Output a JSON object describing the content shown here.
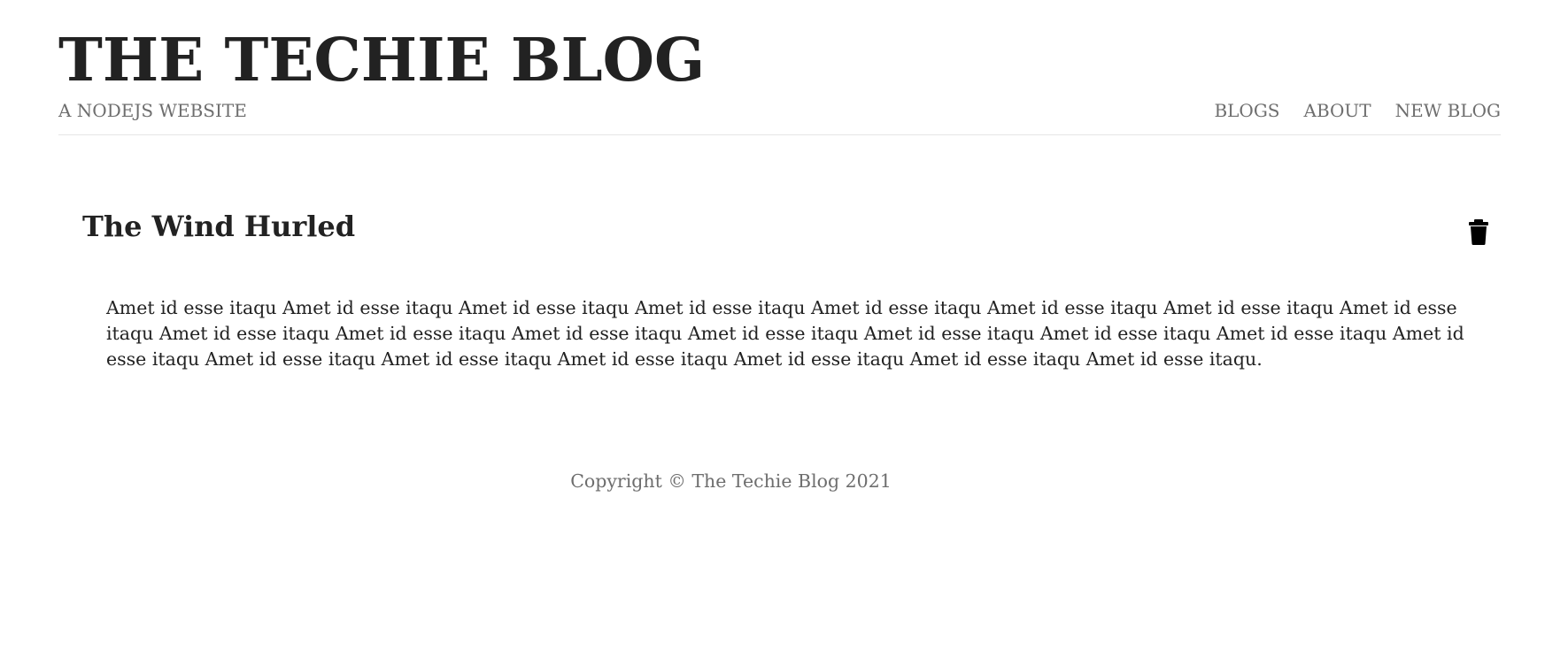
{
  "header": {
    "title": "THE TECHIE BLOG",
    "subtitle": "A NODEJS WEBSITE",
    "nav": [
      {
        "label": "BLOGS"
      },
      {
        "label": "ABOUT"
      },
      {
        "label": "NEW BLOG"
      }
    ]
  },
  "post": {
    "title": "The Wind Hurled",
    "delete_icon": "trash-icon",
    "body": "Amet id esse itaqu Amet id esse itaqu Amet id esse itaqu Amet id esse itaqu Amet id esse itaqu Amet id esse itaqu Amet id esse itaqu Amet id esse itaqu Amet id esse itaqu Amet id esse itaqu Amet id esse itaqu Amet id esse itaqu Amet id esse itaqu Amet id esse itaqu Amet id esse itaqu Amet id esse itaqu Amet id esse itaqu Amet id esse itaqu Amet id esse itaqu Amet id esse itaqu Amet id esse itaqu Amet id esse itaqu."
  },
  "footer": {
    "copyright": "Copyright © The Techie Blog 2021"
  },
  "colors": {
    "text": "#222222",
    "muted": "#6e6e6e",
    "divider": "#e6e6e6",
    "background": "#ffffff"
  }
}
